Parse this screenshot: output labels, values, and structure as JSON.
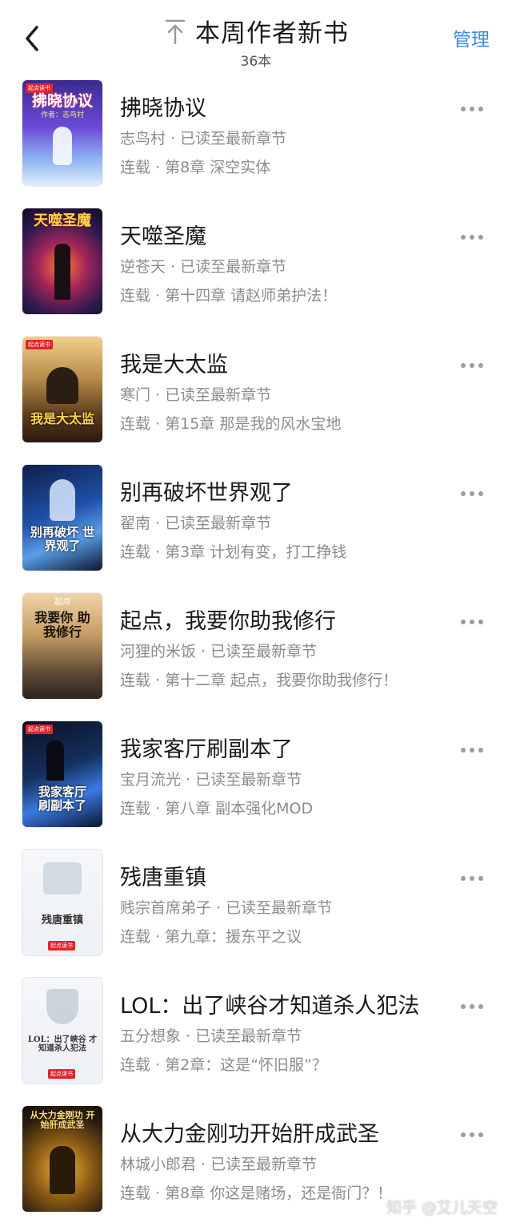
{
  "header": {
    "title": "本周作者新书",
    "count": "36本",
    "manage_label": "管理"
  },
  "books": [
    {
      "title": "拂晓协议",
      "meta": "志鸟村 · 已读至最新章节",
      "chapter": "连载 · 第8章 深空实体",
      "cover_text": "拂晓协议",
      "cover_sub": "作者：志鸟村",
      "cover_badge": "起点读书"
    },
    {
      "title": "天噬圣魔",
      "meta": "逆苍天 · 已读至最新章节",
      "chapter": "连载 · 第十四章 请赵师弟护法！",
      "cover_text": "天噬圣魔"
    },
    {
      "title": "我是大太监",
      "meta": "寒门 · 已读至最新章节",
      "chapter": "连载 · 第15章 那是我的风水宝地",
      "cover_text": "我是大太监",
      "cover_badge": "起点读书"
    },
    {
      "title": "别再破坏世界观了",
      "meta": "翟南 · 已读至最新章节",
      "chapter": "连载 · 第3章 计划有变，打工挣钱",
      "cover_text": "别再破坏 世界观了"
    },
    {
      "title": "起点，我要你助我修行",
      "meta": "河狸的米饭 · 已读至最新章节",
      "chapter": "连载 · 第十二章 起点，我要你助我修行！",
      "cover_text": "我要你 助我修行",
      "cover_sub": "起点"
    },
    {
      "title": "我家客厅刷副本了",
      "meta": "宝月流光 · 已读至最新章节",
      "chapter": "连载 · 第八章 副本强化MOD",
      "cover_text": "我家客厅 刷副本了",
      "cover_badge": "起点读书"
    },
    {
      "title": "残唐重镇",
      "meta": "贱宗首席弟子 · 已读至最新章节",
      "chapter": "连载 · 第九章：援东平之议",
      "cover_text": "残唐重镇",
      "cover_badge": "起点读书"
    },
    {
      "title": "LOL：出了峡谷才知道杀人犯法",
      "meta": "五分想象 · 已读至最新章节",
      "chapter": "连载 · 第2章：这是“怀旧服”？",
      "cover_text": "LOL：出了峡谷 才知道杀人犯法",
      "cover_badge": "起点读书"
    },
    {
      "title": "从大力金刚功开始肝成武圣",
      "meta": "林城小郎君 · 已读至最新章节",
      "chapter": "连载 · 第8章 你这是赌场，还是衙门？！",
      "cover_text": "从大力金刚功 开始肝成武圣"
    }
  ],
  "watermark": "知乎 @艾儿天空",
  "colors": {
    "accent": "#3a8de8",
    "title": "#1a1a1a",
    "meta": "#8c8c8c",
    "more": "#9c9c9c"
  },
  "icons": {
    "back": "chevron-left-icon",
    "pin": "pin-top-icon",
    "more": "more-dots-icon"
  }
}
